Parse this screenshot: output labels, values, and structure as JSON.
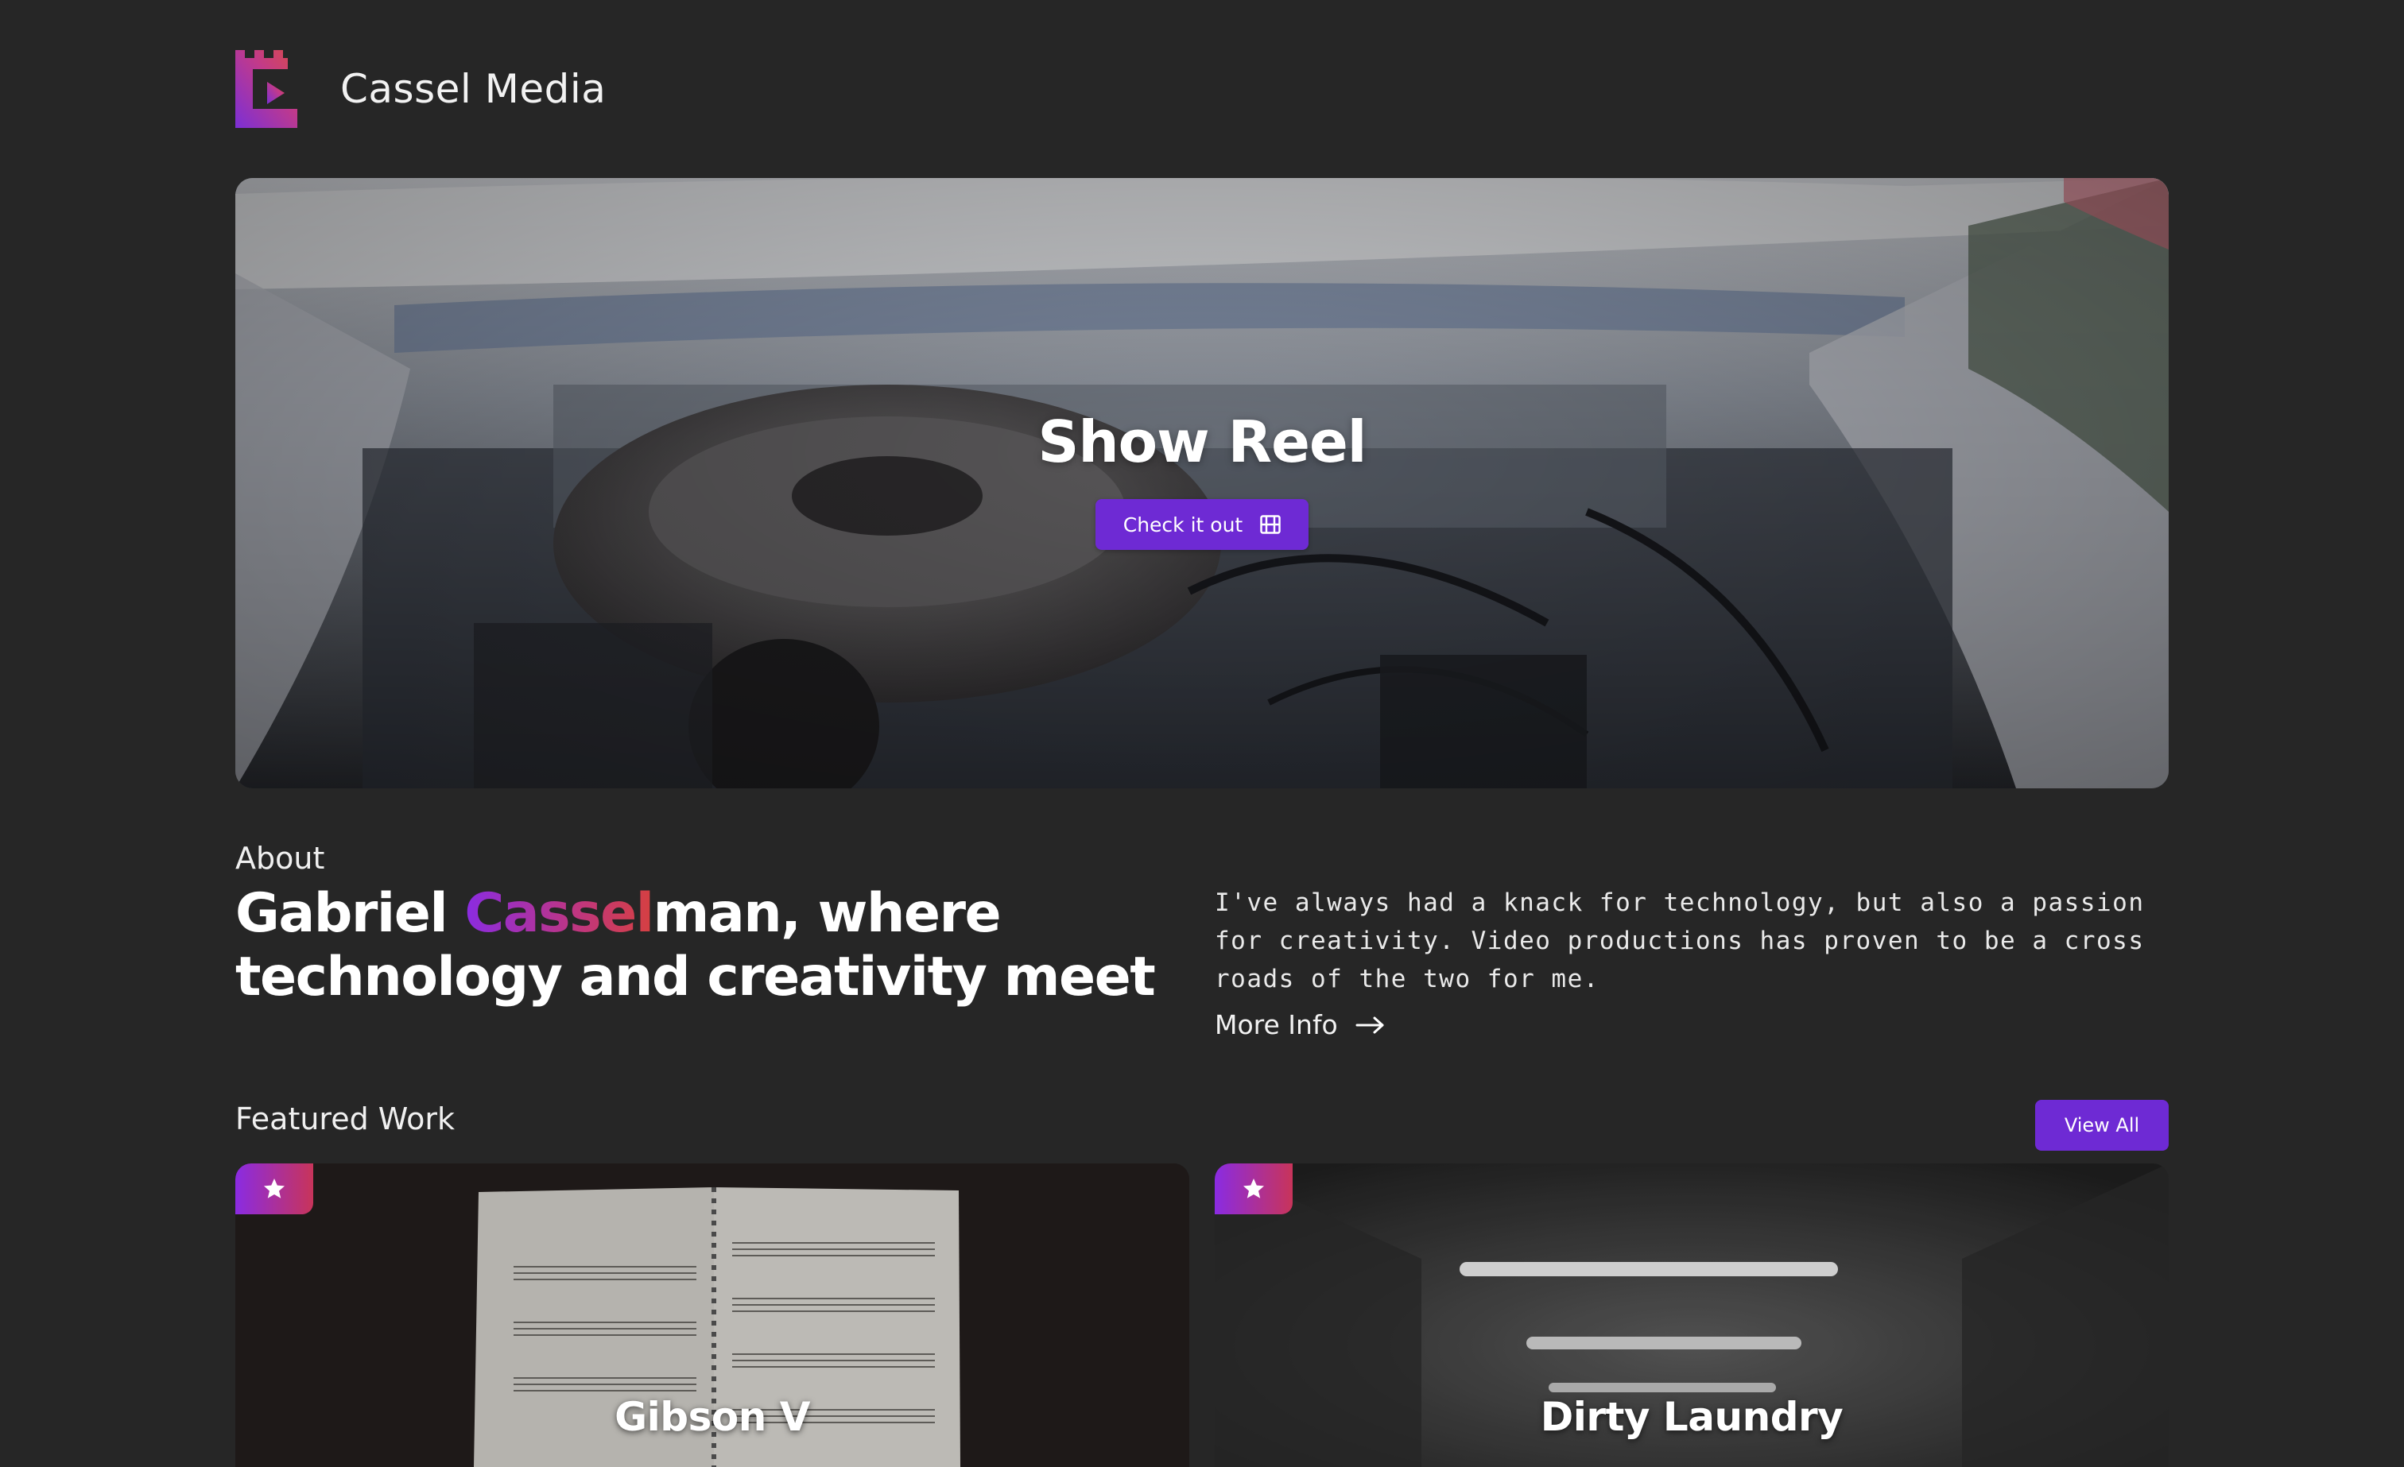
{
  "header": {
    "brand": "Cassel Media",
    "logo_colors": [
      "#7b2fd6",
      "#c23a8a",
      "#d94b4b"
    ]
  },
  "hero": {
    "title": "Show Reel",
    "button_label": "Check it out",
    "button_icon": "film-icon",
    "background": "car-engine-video"
  },
  "about": {
    "label": "About",
    "heading_before": "Gabriel ",
    "heading_accent": "Cassel",
    "heading_after": "man, where technology and creativity meet",
    "text": "I've always had a knack for technology, but also a passion for creativity. Video productions has proven to be a cross roads of the two for me.",
    "more_info_label": "More Info",
    "more_info_icon": "arrow-right-icon"
  },
  "featured": {
    "label": "Featured Work",
    "view_all_label": "View All",
    "items": [
      {
        "title": "Gibson V",
        "badge_icon": "star-icon",
        "thumbnail": "sheet-music"
      },
      {
        "title": "Dirty Laundry",
        "badge_icon": "star-icon",
        "thumbnail": "corridor-lights"
      }
    ]
  },
  "colors": {
    "background": "#262626",
    "accent": "#6e2ad4",
    "gradient_start": "#8a2be2",
    "gradient_end": "#d64040"
  }
}
